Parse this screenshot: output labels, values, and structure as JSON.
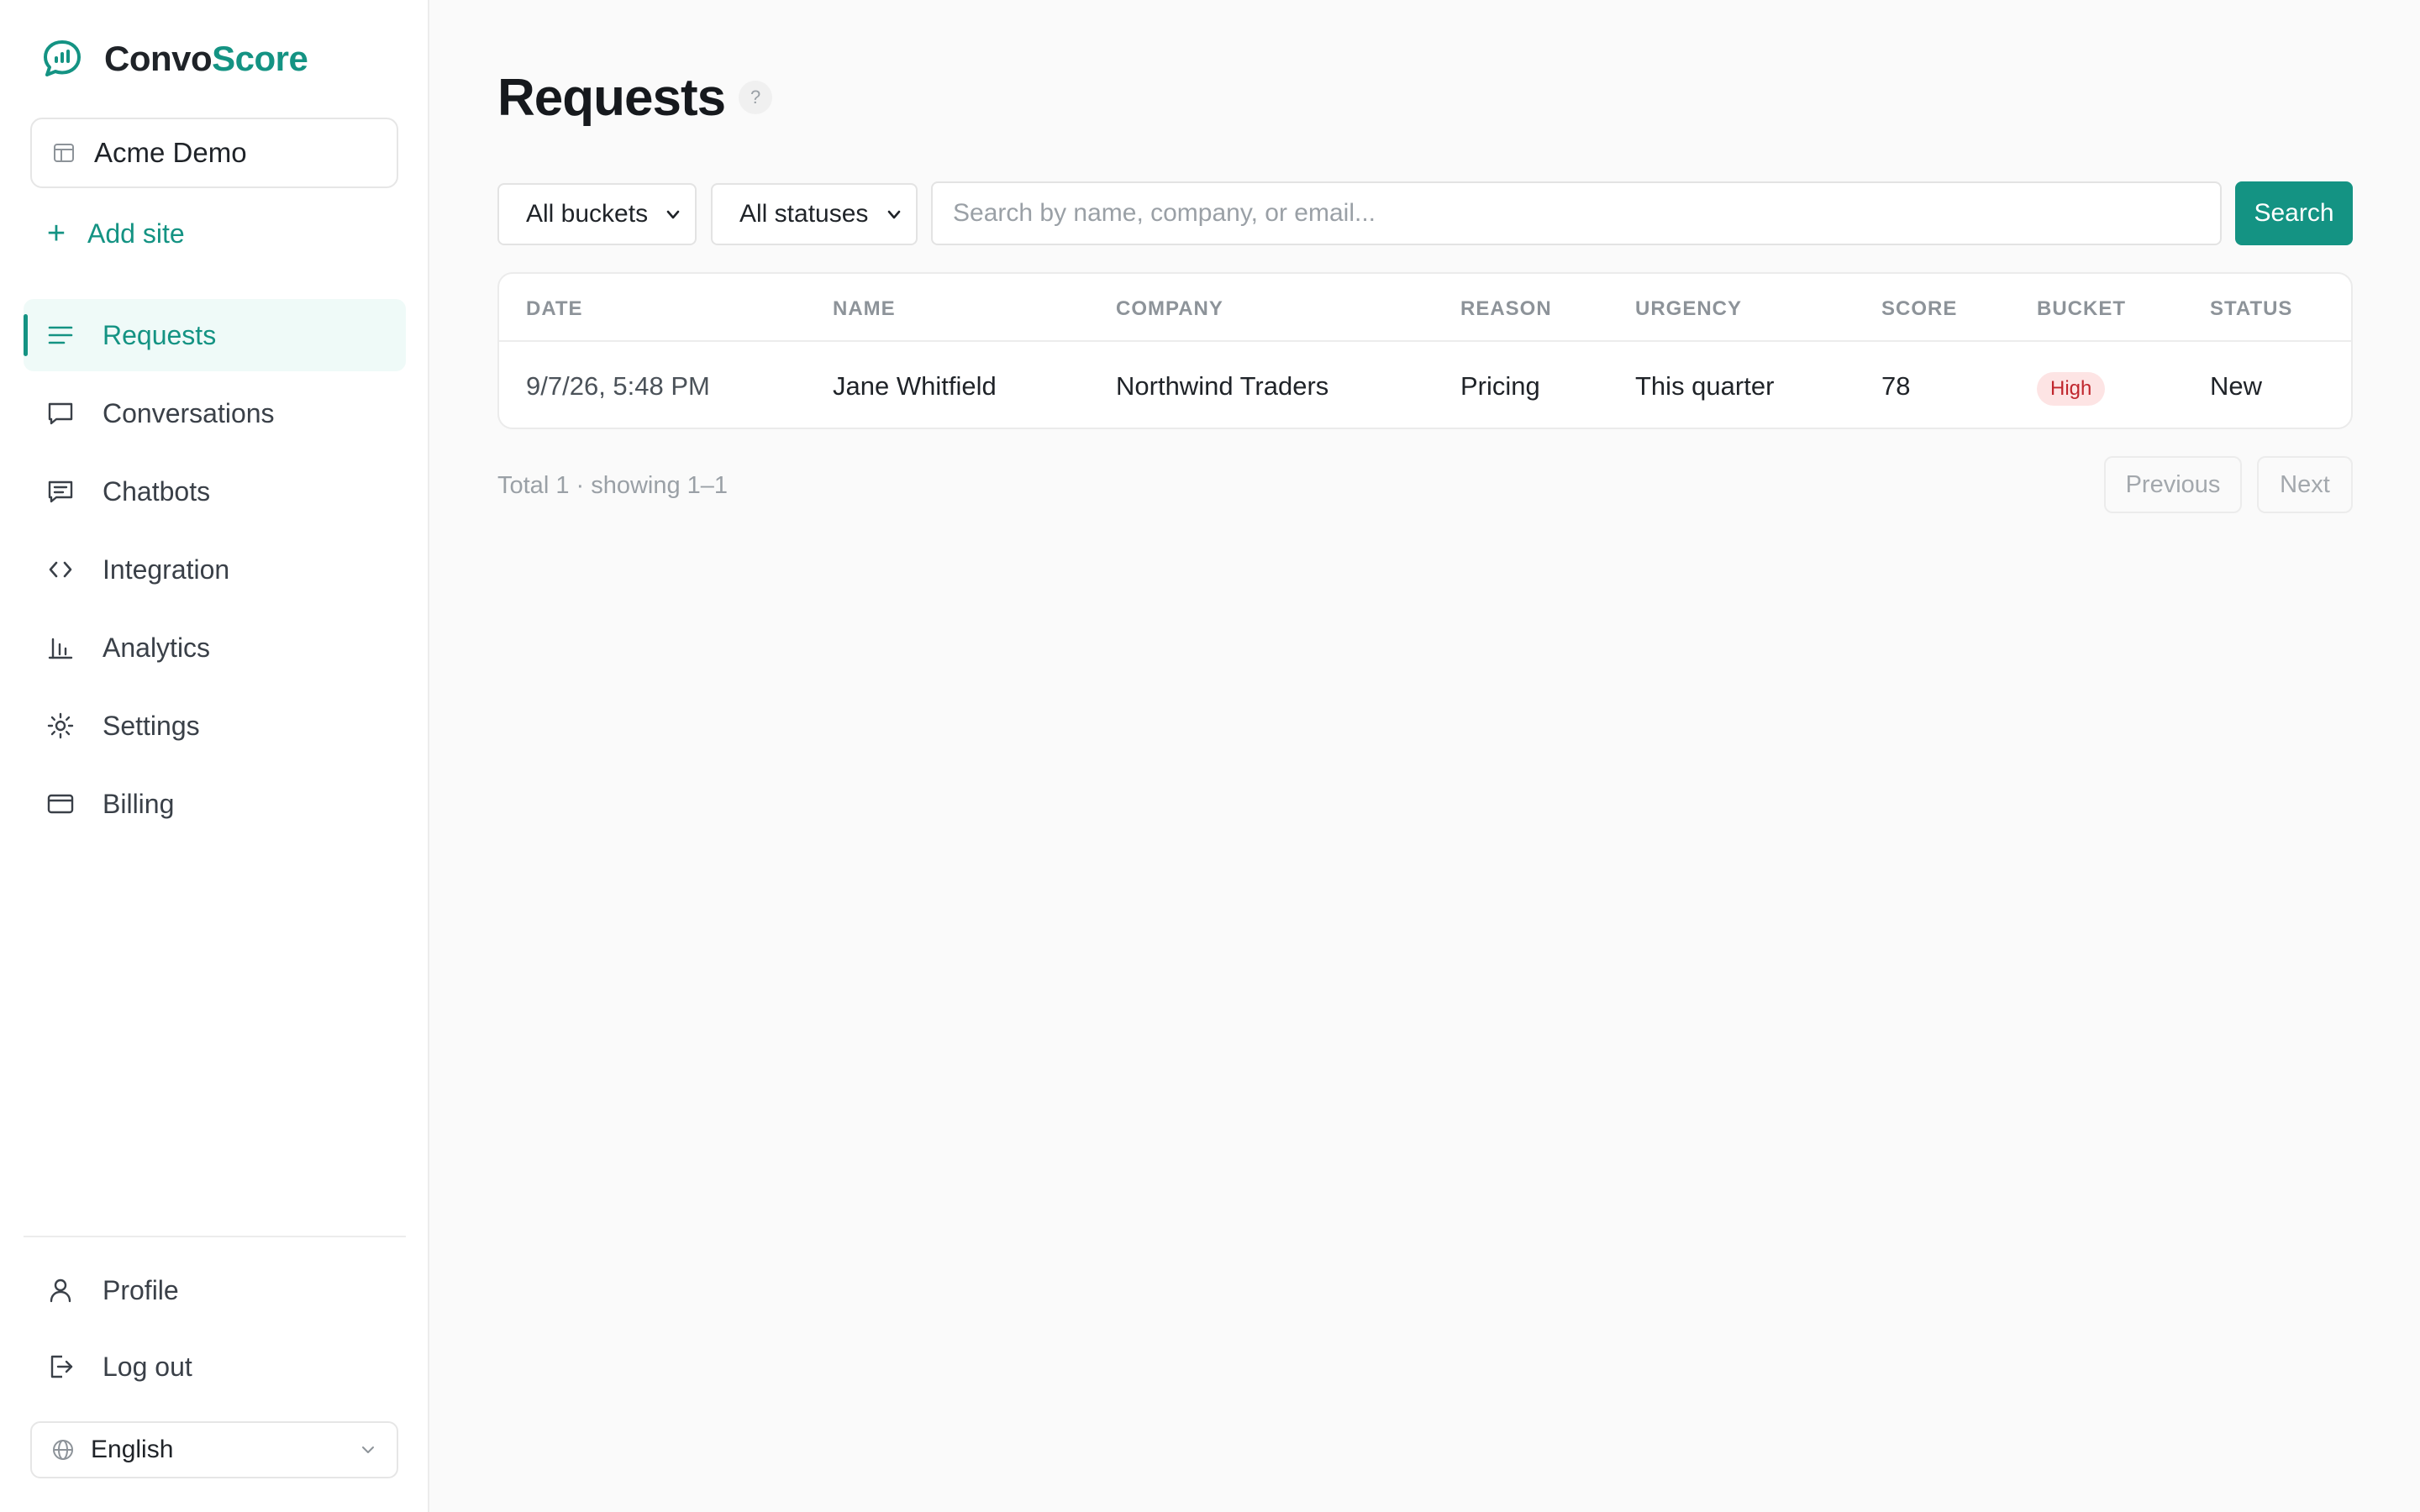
{
  "brand": {
    "part1": "Convo",
    "part2": "Score"
  },
  "site_selector": {
    "label": "Acme Demo"
  },
  "add_site": {
    "label": "Add site"
  },
  "nav": [
    {
      "label": "Requests",
      "icon": "list-icon",
      "active": true
    },
    {
      "label": "Conversations",
      "icon": "message-icon"
    },
    {
      "label": "Chatbots",
      "icon": "chatbot-icon"
    },
    {
      "label": "Integration",
      "icon": "code-icon"
    },
    {
      "label": "Analytics",
      "icon": "bar-chart-icon"
    },
    {
      "label": "Settings",
      "icon": "gear-icon"
    },
    {
      "label": "Billing",
      "icon": "credit-card-icon"
    }
  ],
  "bottom_nav": [
    {
      "label": "Profile",
      "icon": "user-icon"
    },
    {
      "label": "Log out",
      "icon": "logout-icon"
    }
  ],
  "language": {
    "label": "English"
  },
  "page": {
    "title": "Requests",
    "help": "?"
  },
  "filters": {
    "bucket": "All buckets",
    "status": "All statuses",
    "search_placeholder": "Search by name, company, or email...",
    "search_button": "Search"
  },
  "table": {
    "columns": [
      "DATE",
      "NAME",
      "COMPANY",
      "REASON",
      "URGENCY",
      "SCORE",
      "BUCKET",
      "STATUS"
    ],
    "rows": [
      {
        "date": "9/7/26, 5:48 PM",
        "name": "Jane Whitfield",
        "company": "Northwind Traders",
        "reason": "Pricing",
        "urgency": "This quarter",
        "score": "78",
        "bucket": "High",
        "status": "New"
      }
    ]
  },
  "pagination": {
    "summary": "Total 1 · showing 1–1",
    "previous": "Previous",
    "next": "Next"
  },
  "colors": {
    "accent": "#149383",
    "badge_high_bg": "#fde4e4",
    "badge_high_text": "#c0262d"
  }
}
